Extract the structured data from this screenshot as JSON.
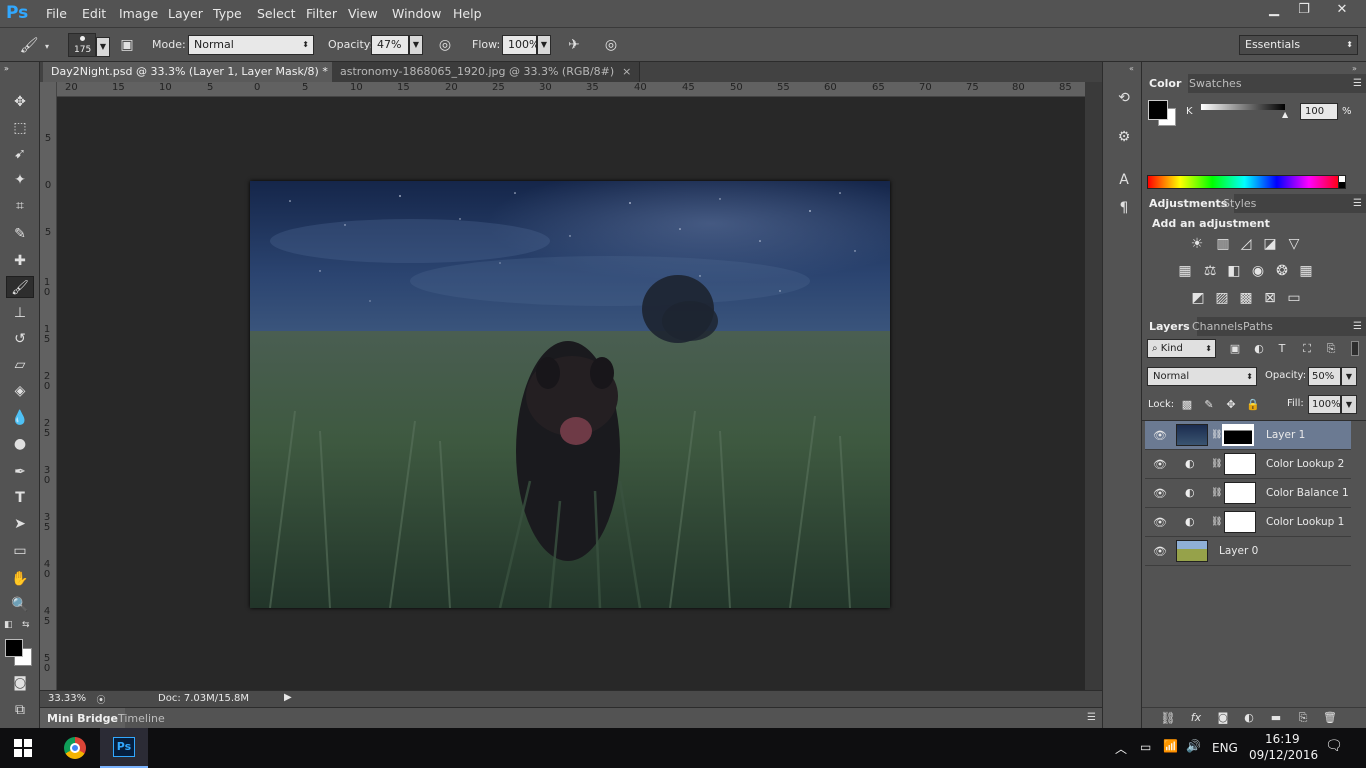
{
  "app": {
    "logo": "Ps"
  },
  "menu": [
    "File",
    "Edit",
    "Image",
    "Layer",
    "Type",
    "Select",
    "Filter",
    "View",
    "Window",
    "Help"
  ],
  "window_controls": {
    "minimize": "▁",
    "restore": "❐",
    "close": "✕"
  },
  "options": {
    "brush_size": "175",
    "mode_label": "Mode:",
    "mode_value": "Normal",
    "opacity_label": "Opacity:",
    "opacity_value": "47%",
    "flow_label": "Flow:",
    "flow_value": "100%",
    "workspace": "Essentials"
  },
  "doc_tabs": [
    {
      "label": "Day2Night.psd @ 33.3% (Layer 1, Layer Mask/8) *",
      "close": "×"
    },
    {
      "label": "astronomy-1868065_1920.jpg @ 33.3% (RGB/8#)",
      "close": "×"
    }
  ],
  "ruler_h": [
    "20",
    "15",
    "10",
    "5",
    "0",
    "5",
    "10",
    "15",
    "20",
    "25",
    "30",
    "35",
    "40",
    "45",
    "50",
    "55",
    "60",
    "65",
    "70",
    "75",
    "80",
    "85"
  ],
  "ruler_v": [
    "5",
    "0",
    "5",
    "1 0",
    "1 5",
    "2 0",
    "2 5",
    "3 0",
    "3 5",
    "4 0",
    "4 5",
    "5 0"
  ],
  "status": {
    "zoom": "33.33%",
    "doc": "Doc: 7.03M/15.8M"
  },
  "bottom_tabs": [
    "Mini Bridge",
    "Timeline"
  ],
  "color_panel": {
    "tabs": [
      "Color",
      "Swatches"
    ],
    "channel": "K",
    "value": "100",
    "unit": "%"
  },
  "adjustments_panel": {
    "tabs": [
      "Adjustments",
      "Styles"
    ],
    "heading": "Add an adjustment"
  },
  "layers_panel": {
    "tabs": [
      "Layers",
      "Channels",
      "Paths"
    ],
    "kind": "Kind",
    "blend_mode": "Normal",
    "opacity_label": "Opacity:",
    "opacity_value": "50%",
    "lock_label": "Lock:",
    "fill_label": "Fill:",
    "fill_value": "100%",
    "layers": [
      {
        "name": "Layer 1"
      },
      {
        "name": "Color Lookup 2"
      },
      {
        "name": "Color Balance 1"
      },
      {
        "name": "Color Lookup 1"
      },
      {
        "name": "Layer 0"
      }
    ]
  },
  "taskbar": {
    "language": "ENG",
    "time": "16:19",
    "date": "09/12/2016"
  }
}
